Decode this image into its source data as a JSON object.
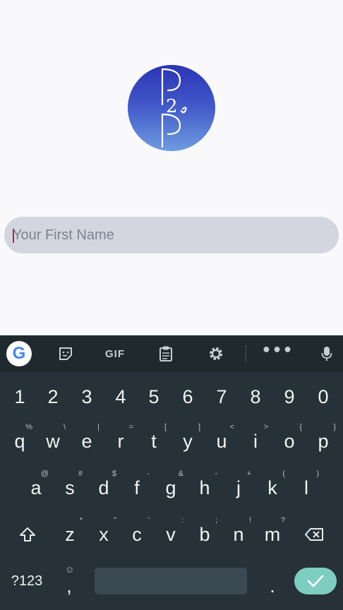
{
  "logo": {
    "text_top": "P",
    "text_mid": "2",
    "text_bottom": "P"
  },
  "name_field": {
    "placeholder": "Your First Name",
    "value": ""
  },
  "keyboard": {
    "toolbar": {
      "google_label": "G",
      "gif_label": "GIF",
      "more_label": "•••"
    },
    "number_row": [
      "1",
      "2",
      "3",
      "4",
      "5",
      "6",
      "7",
      "8",
      "9",
      "0"
    ],
    "row1": [
      {
        "key": "q",
        "hint": "%"
      },
      {
        "key": "w",
        "hint": "\\"
      },
      {
        "key": "e",
        "hint": "|"
      },
      {
        "key": "r",
        "hint": "="
      },
      {
        "key": "t",
        "hint": "["
      },
      {
        "key": "y",
        "hint": "]"
      },
      {
        "key": "u",
        "hint": "<"
      },
      {
        "key": "i",
        "hint": ">"
      },
      {
        "key": "o",
        "hint": "{"
      },
      {
        "key": "p",
        "hint": "}"
      }
    ],
    "row2": [
      {
        "key": "a",
        "hint": "@"
      },
      {
        "key": "s",
        "hint": "#"
      },
      {
        "key": "d",
        "hint": "$"
      },
      {
        "key": "f",
        "hint": "-"
      },
      {
        "key": "g",
        "hint": "&"
      },
      {
        "key": "h",
        "hint": "-"
      },
      {
        "key": "j",
        "hint": "+"
      },
      {
        "key": "k",
        "hint": "("
      },
      {
        "key": "l",
        "hint": ")"
      }
    ],
    "row3": [
      {
        "key": "z",
        "hint": "*"
      },
      {
        "key": "x",
        "hint": "\""
      },
      {
        "key": "c",
        "hint": "'"
      },
      {
        "key": "v",
        "hint": ":"
      },
      {
        "key": "b",
        "hint": ";"
      },
      {
        "key": "n",
        "hint": "!"
      },
      {
        "key": "m",
        "hint": "?"
      }
    ],
    "symbols_label": "?123",
    "comma_label": ",",
    "period_label": "."
  }
}
